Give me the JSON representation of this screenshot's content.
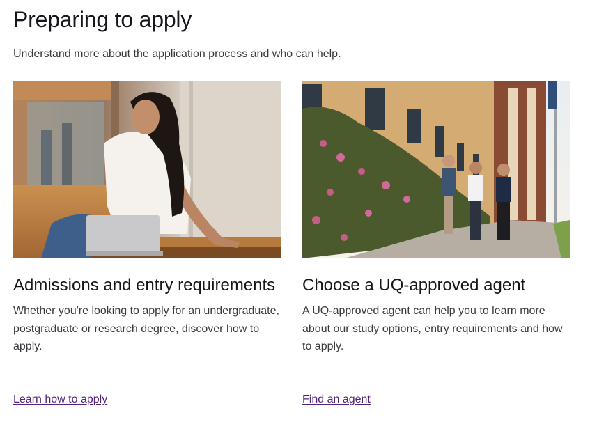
{
  "page": {
    "title": "Preparing to apply",
    "intro": "Understand more about the application process and who can help."
  },
  "cards": [
    {
      "image_alt": "Student with laptop",
      "title": "Admissions and entry requirements",
      "description": "Whether you're looking to apply for an undergraduate, postgraduate or research degree, discover how to apply.",
      "link_label": "Learn how to apply"
    },
    {
      "image_alt": "Students walking on campus",
      "title": "Choose a UQ-approved agent",
      "description": "A UQ-approved agent can help you to learn more about our study options, entry requirements and how to apply.",
      "link_label": "Find an agent"
    }
  ],
  "colors": {
    "link": "#51247a",
    "heading": "#19151c",
    "body_text": "#3b383e"
  }
}
